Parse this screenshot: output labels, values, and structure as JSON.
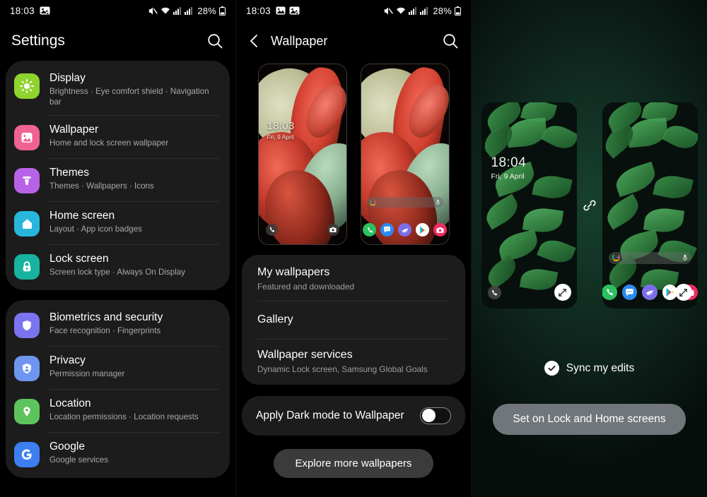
{
  "statusbar": {
    "time_left": "18:03",
    "time_middle": "18:03",
    "battery_percent": "28%",
    "icons": [
      "image-icon",
      "screenshot-icon",
      "mute-icon",
      "wifi-icon",
      "signal-icon",
      "signal-icon",
      "battery-icon"
    ]
  },
  "settings": {
    "title": "Settings",
    "search_label": "Search",
    "groups": [
      {
        "items": [
          {
            "title": "Display",
            "subtitle": "Brightness  ·  Eye comfort shield  ·  Navigation bar",
            "icon": "brightness-icon",
            "color": "#8fd32f"
          },
          {
            "title": "Wallpaper",
            "subtitle": "Home and lock screen wallpaper",
            "icon": "image-icon",
            "color": "#f06292"
          },
          {
            "title": "Themes",
            "subtitle": "Themes  ·  Wallpapers  ·  Icons",
            "icon": "themes-icon",
            "color": "#b862e8"
          },
          {
            "title": "Home screen",
            "subtitle": "Layout  ·  App icon badges",
            "icon": "home-icon",
            "color": "#29b6dd"
          },
          {
            "title": "Lock screen",
            "subtitle": "Screen lock type  ·  Always On Display",
            "icon": "lock-icon",
            "color": "#18b3a0"
          }
        ]
      },
      {
        "items": [
          {
            "title": "Biometrics and security",
            "subtitle": "Face recognition  ·  Fingerprints",
            "icon": "shield-icon",
            "color": "#7a74f0"
          },
          {
            "title": "Privacy",
            "subtitle": "Permission manager",
            "icon": "privacy-shield-icon",
            "color": "#6e95f0"
          },
          {
            "title": "Location",
            "subtitle": "Location permissions  ·  Location requests",
            "icon": "location-pin-icon",
            "color": "#5dc45d"
          },
          {
            "title": "Google",
            "subtitle": "Google services",
            "icon": "google-icon",
            "color": "#3d7ff0"
          }
        ]
      }
    ]
  },
  "wallpaper": {
    "title": "Wallpaper",
    "back_label": "Back",
    "search_label": "Search",
    "preview_lock": {
      "time": "18:03",
      "date": "Fri, 9 April",
      "left_shortcut": "phone-icon",
      "right_shortcut": "camera-icon"
    },
    "preview_home": {
      "search_placeholder": "",
      "dock": [
        "phone-icon",
        "messages-icon",
        "internet-icon",
        "play-store-icon",
        "camera-icon"
      ]
    },
    "options": [
      {
        "title": "My wallpapers",
        "subtitle": "Featured and downloaded"
      },
      {
        "title": "Gallery",
        "subtitle": ""
      },
      {
        "title": "Wallpaper services",
        "subtitle": "Dynamic Lock screen, Samsung Global Goals"
      }
    ],
    "dark_mode_toggle": {
      "label": "Apply Dark mode to Wallpaper",
      "state": "off"
    },
    "explore_button": "Explore more wallpapers"
  },
  "preview": {
    "lock": {
      "time": "18:04",
      "date": "Fri, 9 April",
      "lock_shortcut": "phone-icon",
      "edit_label": "Edit"
    },
    "home": {
      "dock": [
        "phone-icon",
        "messages-icon",
        "internet-icon",
        "play-store-icon",
        "camera-icon"
      ],
      "edit_label": "Edit"
    },
    "link_icon": "link-icon",
    "sync_label": "Sync my edits",
    "set_button": "Set on Lock and Home screens"
  }
}
